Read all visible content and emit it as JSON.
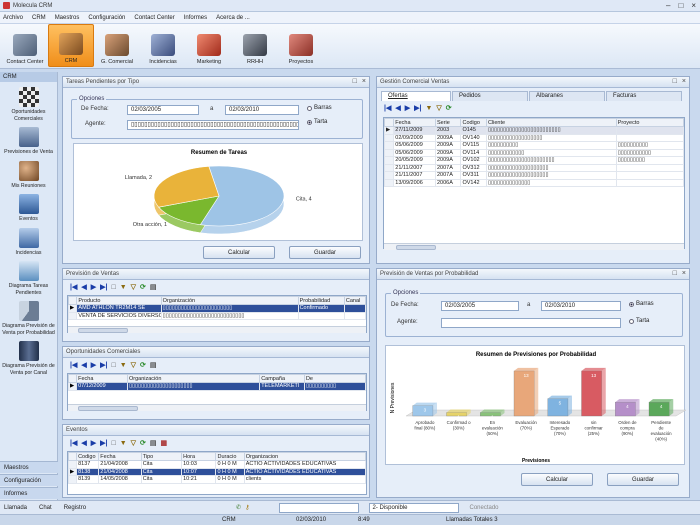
{
  "app": {
    "title": "Molecula CRM"
  },
  "menu": [
    "Archivo",
    "CRM",
    "Maestros",
    "Configuración",
    "Contact Center",
    "Informes",
    "Acerca de ..."
  ],
  "toolbar": [
    {
      "label": "Contact Center",
      "icon": "contact-center-icon",
      "color": "#6d7f95"
    },
    {
      "label": "CRM",
      "icon": "crm-icon",
      "color": "#b36a22"
    },
    {
      "label": "G. Comercial",
      "icon": "commercial-icon",
      "color": "#b06d3b"
    },
    {
      "label": "Incidencias",
      "icon": "incidents-icon",
      "color": "#566a9c"
    },
    {
      "label": "Marketing",
      "icon": "marketing-icon",
      "color": "#c03b2a"
    },
    {
      "label": "RRHH",
      "icon": "hr-icon",
      "color": "#555b66"
    },
    {
      "label": "Proyectos",
      "icon": "projects-icon",
      "color": "#a8473d"
    }
  ],
  "sidebar": {
    "header": "CRM",
    "items": [
      {
        "label": "Oportunidades Comerciales",
        "icon": "chess-icon",
        "color": "#444a55"
      },
      {
        "label": "Previsiones de Venta",
        "icon": "phone-icon",
        "color": "#4d6b93"
      },
      {
        "label": "Mis Reuniones",
        "icon": "meeting-icon",
        "color": "#8a5b32"
      },
      {
        "label": "Eventos",
        "icon": "monitor-icon",
        "color": "#3f6aa8"
      },
      {
        "label": "Incidencias",
        "icon": "incident-icon",
        "color": "#4a74b0"
      },
      {
        "label": "Diagrama Tareas Pendientes",
        "icon": "chart-icon",
        "color": "#5a8fc0"
      },
      {
        "label": "Diagrama Previsión de Venta por Probabilidad",
        "icon": "pie-icon",
        "color": "#5b6b80"
      },
      {
        "label": "Diagrama Previsión de Venta por Canal",
        "icon": "books-icon",
        "color": "#2e3f60"
      }
    ],
    "bottom": [
      "Maestros",
      "Configuración",
      "Informes"
    ]
  },
  "tareas": {
    "title": "Tareas Pendientes por Tipo",
    "options_legend": "Opciones",
    "de_fecha_label": "De Fecha:",
    "date_from": "02/03/2005",
    "a_label": "a",
    "date_to": "02/03/2010",
    "agente_label": "Agente:",
    "agente_value": "▯▯▯▯▯▯▯▯▯▯▯▯▯▯▯▯▯▯▯▯▯▯▯▯▯▯▯▯▯▯▯▯▯▯▯▯▯▯▯▯▯▯▯▯▯▯▯▯▯▯▯▯▯",
    "radio_barras": "Barras",
    "radio_tarta": "Tarta",
    "calc": "Calcular",
    "save": "Guardar"
  },
  "chart_data": [
    {
      "type": "pie",
      "title": "Resumen de Tareas",
      "labels": [
        "Cita, 4",
        "Otra acción, 1",
        "Llamada, 2"
      ],
      "values": [
        4,
        1,
        2
      ],
      "colors": [
        "#9ec4e6",
        "#7ab82e",
        "#e9b33a"
      ]
    },
    {
      "type": "bar",
      "title": "Resumen de Previsiones por Probabilidad",
      "ylabel": "N Previsiones",
      "xlabel": "Previsiones",
      "categories": [
        "Aprobado final (80%)",
        "Confirmad o (30%)",
        "En evaluación (50%)",
        "Evaluación (70%)",
        "Interesado Esperado (70%)",
        "sin confirmar (25%)",
        "Orden de compra (90%)",
        "Pendiente de evaluación (40%)"
      ],
      "values": [
        3,
        1,
        1,
        13,
        5,
        13,
        4,
        4
      ],
      "colors": [
        "#9ec7ea",
        "#e6d36a",
        "#89c27a",
        "#e8a77a",
        "#7fb3e0",
        "#d85b62",
        "#b58fc9",
        "#5ba85b"
      ]
    }
  ],
  "gestion": {
    "title": "Gestión Comercial Ventas",
    "tabs": [
      "Ofertas",
      "Pedidos",
      "Albaranes",
      "Facturas"
    ],
    "columns": [
      "Fecha",
      "Serie",
      "Codigo",
      "Cliente",
      "Proyecto"
    ],
    "rows": [
      [
        "27/11/2009",
        "2003",
        "O145",
        "▯▯▯▯▯▯▯▯▯▯▯▯▯▯▯▯▯▯▯▯▯▯▯▯",
        ""
      ],
      [
        "02/09/2009",
        "2009A",
        "OV140",
        "▯▯▯▯▯▯▯▯▯▯▯▯▯▯▯▯▯▯",
        ""
      ],
      [
        "05/06/2009",
        "2009A",
        "OV115",
        "▯▯▯▯▯▯▯▯▯▯",
        "▯▯▯▯▯▯▯▯▯▯"
      ],
      [
        "05/06/2009",
        "2009A",
        "OV114",
        "▯▯▯▯▯▯▯▯▯▯▯▯",
        "▯▯▯▯▯▯▯▯▯▯▯"
      ],
      [
        "20/05/2009",
        "2009A",
        "OV102",
        "▯▯▯▯▯▯▯▯▯▯▯▯▯▯▯▯▯▯▯▯▯▯",
        "▯▯▯▯▯▯▯▯▯"
      ],
      [
        "21/11/2007",
        "2007A",
        "OV312",
        "▯▯▯▯▯▯▯▯▯▯▯▯▯▯▯▯▯▯▯▯",
        ""
      ],
      [
        "21/11/2007",
        "2007A",
        "OV311",
        "▯▯▯▯▯▯▯▯▯▯▯▯▯▯▯▯▯▯▯▯",
        ""
      ],
      [
        "13/09/2006",
        "2006A",
        "OV142",
        "▯▯▯▯▯▯▯▯▯▯▯▯▯▯",
        ""
      ]
    ]
  },
  "prevision_ventas": {
    "title": "Previsión de Ventas",
    "columns": [
      "Producto",
      "Organización",
      "Probabilidad",
      "Canal"
    ],
    "rows": [
      [
        "AMD ATHLON TR2M14 SE",
        "▯▯▯▯▯▯▯▯▯▯▯▯▯▯▯▯▯▯▯▯▯▯▯",
        "Confirmado",
        ""
      ],
      [
        "VENTA DE SERVICIOS DIVERSO",
        "▯▯▯▯▯▯▯▯▯▯▯▯▯▯▯▯▯▯▯▯▯▯▯▯▯▯▯",
        "",
        ""
      ]
    ]
  },
  "oportunidades": {
    "title": "Oportunidades Comerciales",
    "columns": [
      "Fecha",
      "Organización",
      "Campaña",
      "De"
    ],
    "rows": [
      [
        "07/12/2009",
        "▯▯▯▯▯▯▯▯▯▯▯▯▯▯▯▯▯▯▯▯▯",
        "TELEMARKETI",
        "▯▯▯▯▯▯▯▯▯▯"
      ]
    ]
  },
  "eventos": {
    "title": "Eventos",
    "columns": [
      "Codigo",
      "Fecha",
      "Tipo",
      "Hora",
      "Duracio",
      "Organizacion"
    ],
    "rows": [
      [
        "8137",
        "21/04/2008",
        "Cita",
        "10:03",
        "0 H 0 M",
        "ACTIO ACTIVIDADES EDUCATIVAS"
      ],
      [
        "8138",
        "21/04/2008",
        "Cita",
        "10:07",
        "0 H 0 M",
        "ACTIO ACTIVIDADES EDUCATIVAS"
      ],
      [
        "8139",
        "14/05/2008",
        "Cita",
        "10:21",
        "0 H 0 M",
        "clients"
      ]
    ]
  },
  "prob": {
    "title": "Previsión de Ventas por Probabilidad",
    "options_legend": "Opciones",
    "de_fecha_label": "De Fecha:",
    "date_from": "02/03/2005",
    "a_label": "a",
    "date_to": "02/03/2010",
    "agente_label": "Agente:",
    "radio_barras": "Barras",
    "radio_tarta": "Tarta",
    "calc": "Calcular",
    "save": "Guardar"
  },
  "status": {
    "llamada": "Llamada",
    "chat": "Chat",
    "registro": "Registro",
    "disponible": "2- Disponible",
    "conectado": "Conectado",
    "crm": "CRM",
    "date": "02/03/2010",
    "time": "8:49",
    "llamadas": "Llamadas Totales 3"
  }
}
